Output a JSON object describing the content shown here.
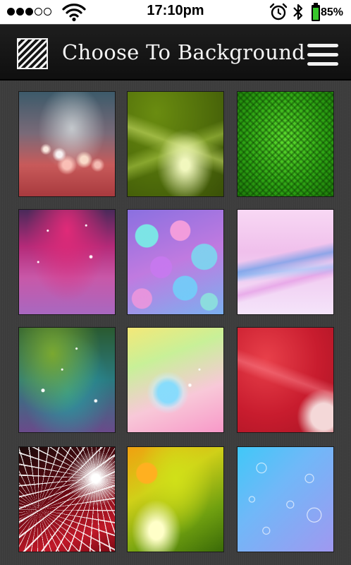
{
  "status_bar": {
    "signal_dots": [
      "full",
      "full",
      "full",
      "empty",
      "empty"
    ],
    "time": "17:10pm",
    "battery_percent": "85%",
    "icons": [
      "signal-dots-icon",
      "wifi-icon",
      "alarm-clock-icon",
      "bluetooth-icon",
      "battery-icon"
    ]
  },
  "header": {
    "logo_icon": "striped-logo-icon",
    "title": "Choose To Background",
    "menu_icon": "hamburger-menu-icon"
  },
  "wallpapers": [
    {
      "name": "bokeh-lights-red"
    },
    {
      "name": "green-abstract-swirl"
    },
    {
      "name": "green-hexagon-mesh"
    },
    {
      "name": "pink-purple-sparkles"
    },
    {
      "name": "colorful-bokeh-circles"
    },
    {
      "name": "pink-blue-waves"
    },
    {
      "name": "green-teal-galaxy"
    },
    {
      "name": "pastel-light-burst"
    },
    {
      "name": "red-silk-waves"
    },
    {
      "name": "white-starburst-red"
    },
    {
      "name": "yellow-green-abstract"
    },
    {
      "name": "blue-bubbles"
    }
  ],
  "colors": {
    "header_bg": "#141414",
    "header_text": "#f4f4f4",
    "content_bg": "#3c3c3c",
    "status_bar_bg": "#ffffff",
    "battery_green": "#39c82c"
  }
}
